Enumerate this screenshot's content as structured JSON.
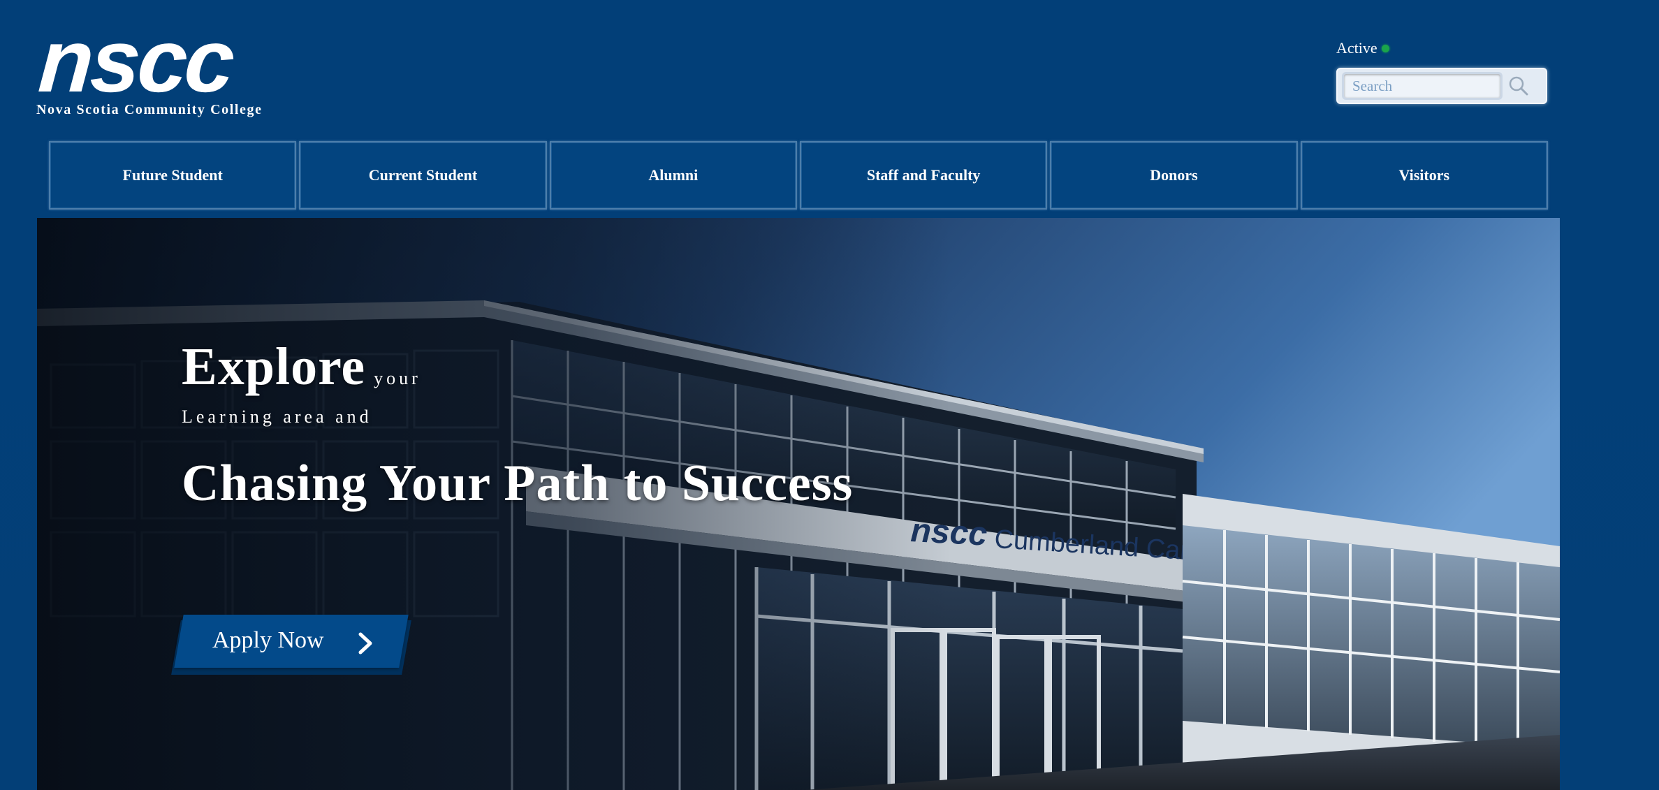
{
  "brand": {
    "logo_mark": "nscc",
    "logo_subtitle": "Nova Scotia Community College"
  },
  "status": {
    "label": "Active",
    "indicator_color": "#1aa54b"
  },
  "search": {
    "placeholder": "Search",
    "value": "",
    "button_icon": "search-icon"
  },
  "nav": {
    "items": [
      {
        "label": "Future Student"
      },
      {
        "label": "Current Student"
      },
      {
        "label": "Alumni"
      },
      {
        "label": "Staff and Faculty"
      },
      {
        "label": "Donors"
      },
      {
        "label": "Visitors"
      }
    ]
  },
  "hero": {
    "explore_big": "Explore",
    "explore_small": "your",
    "learning_line": "Learning area and",
    "headline": "Chasing Your Path to Success",
    "cta_label": "Apply Now",
    "cta_icon": "chevron-right-icon",
    "image_description_signage": {
      "logo": "nscc",
      "campus": "Cumberland Campus"
    }
  },
  "colors": {
    "page_background": "#023f78",
    "nav_border": "#4d7eab",
    "cta_background": "#034a8a",
    "text": "#ffffff"
  }
}
